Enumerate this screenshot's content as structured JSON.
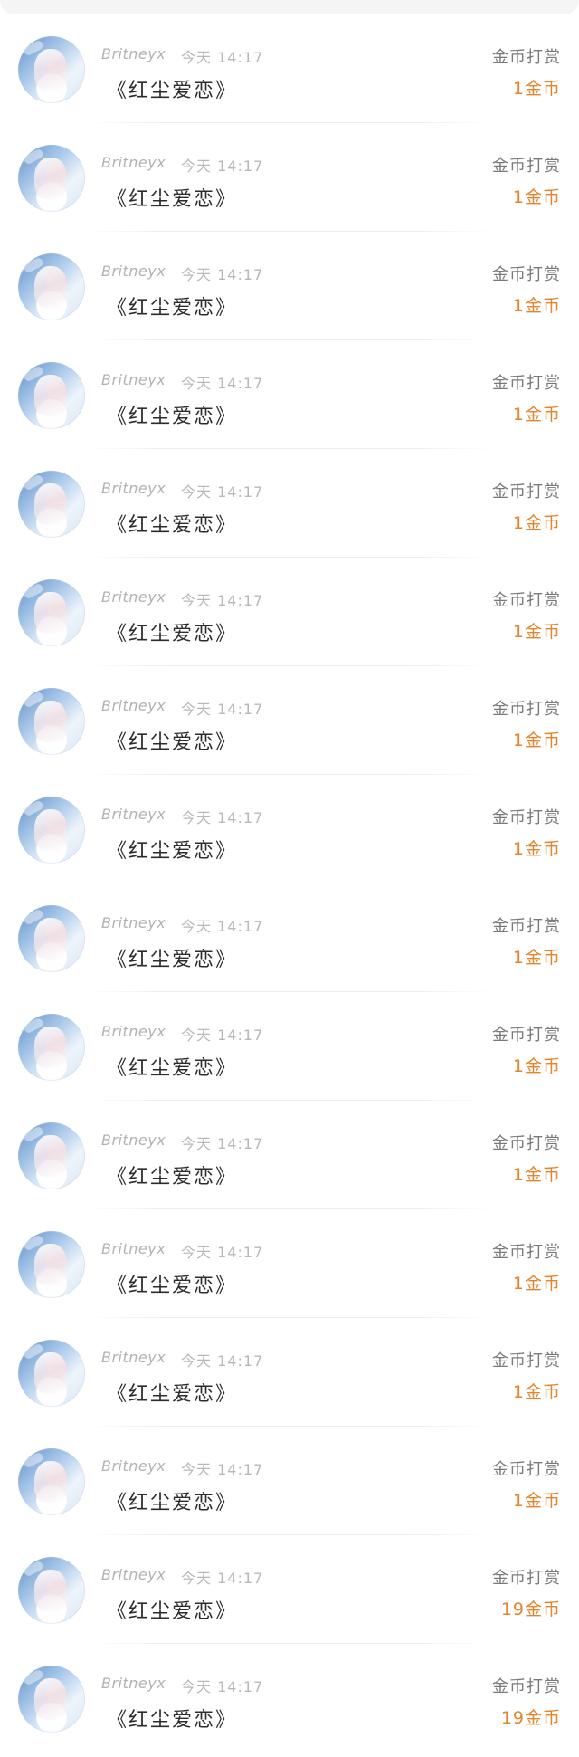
{
  "rows": [
    {
      "username": "Britneyx",
      "time": "今天 14:17",
      "song": "《红尘爱恋》",
      "reward_label": "金币打赏",
      "reward_amount": "1金币"
    },
    {
      "username": "Britneyx",
      "time": "今天 14:17",
      "song": "《红尘爱恋》",
      "reward_label": "金币打赏",
      "reward_amount": "1金币"
    },
    {
      "username": "Britneyx",
      "time": "今天 14:17",
      "song": "《红尘爱恋》",
      "reward_label": "金币打赏",
      "reward_amount": "1金币"
    },
    {
      "username": "Britneyx",
      "time": "今天 14:17",
      "song": "《红尘爱恋》",
      "reward_label": "金币打赏",
      "reward_amount": "1金币"
    },
    {
      "username": "Britneyx",
      "time": "今天 14:17",
      "song": "《红尘爱恋》",
      "reward_label": "金币打赏",
      "reward_amount": "1金币"
    },
    {
      "username": "Britneyx",
      "time": "今天 14:17",
      "song": "《红尘爱恋》",
      "reward_label": "金币打赏",
      "reward_amount": "1金币"
    },
    {
      "username": "Britneyx",
      "time": "今天 14:17",
      "song": "《红尘爱恋》",
      "reward_label": "金币打赏",
      "reward_amount": "1金币"
    },
    {
      "username": "Britneyx",
      "time": "今天 14:17",
      "song": "《红尘爱恋》",
      "reward_label": "金币打赏",
      "reward_amount": "1金币"
    },
    {
      "username": "Britneyx",
      "time": "今天 14:17",
      "song": "《红尘爱恋》",
      "reward_label": "金币打赏",
      "reward_amount": "1金币"
    },
    {
      "username": "Britneyx",
      "time": "今天 14:17",
      "song": "《红尘爱恋》",
      "reward_label": "金币打赏",
      "reward_amount": "1金币"
    },
    {
      "username": "Britneyx",
      "time": "今天 14:17",
      "song": "《红尘爱恋》",
      "reward_label": "金币打赏",
      "reward_amount": "1金币"
    },
    {
      "username": "Britneyx",
      "time": "今天 14:17",
      "song": "《红尘爱恋》",
      "reward_label": "金币打赏",
      "reward_amount": "1金币"
    },
    {
      "username": "Britneyx",
      "time": "今天 14:17",
      "song": "《红尘爱恋》",
      "reward_label": "金币打赏",
      "reward_amount": "1金币"
    },
    {
      "username": "Britneyx",
      "time": "今天 14:17",
      "song": "《红尘爱恋》",
      "reward_label": "金币打赏",
      "reward_amount": "1金币"
    },
    {
      "username": "Britneyx",
      "time": "今天 14:17",
      "song": "《红尘爱恋》",
      "reward_label": "金币打赏",
      "reward_amount": "19金币"
    },
    {
      "username": "Britneyx",
      "time": "今天 14:17",
      "song": "《红尘爱恋》",
      "reward_label": "金币打赏",
      "reward_amount": "19金币"
    }
  ],
  "colors": {
    "reward_amount": "#e2852e",
    "song_text": "#2c2c2c",
    "meta_text": "#b2b2b2"
  }
}
